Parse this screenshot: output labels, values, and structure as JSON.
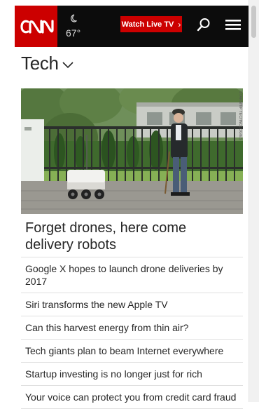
{
  "header": {
    "logo_text": "CNN",
    "weather_icon": "moon-icon",
    "temperature": "67°",
    "watch_live_label": "Watch Live TV",
    "brand_red": "#cc0000",
    "bar_color": "#0c0c0c"
  },
  "section": {
    "title": "Tech"
  },
  "hero": {
    "credit": "STARSHIP TECHNOLOGIES"
  },
  "headline": "Forget drones, here come delivery robots",
  "stories": [
    "Google X hopes to launch drone deliveries by 2017",
    "Siri transforms the new Apple TV",
    "Can this harvest energy from thin air?",
    "Tech giants plan to beam Internet everywhere",
    "Startup investing is no longer just for rich",
    "Your voice can protect you from credit card fraud"
  ]
}
